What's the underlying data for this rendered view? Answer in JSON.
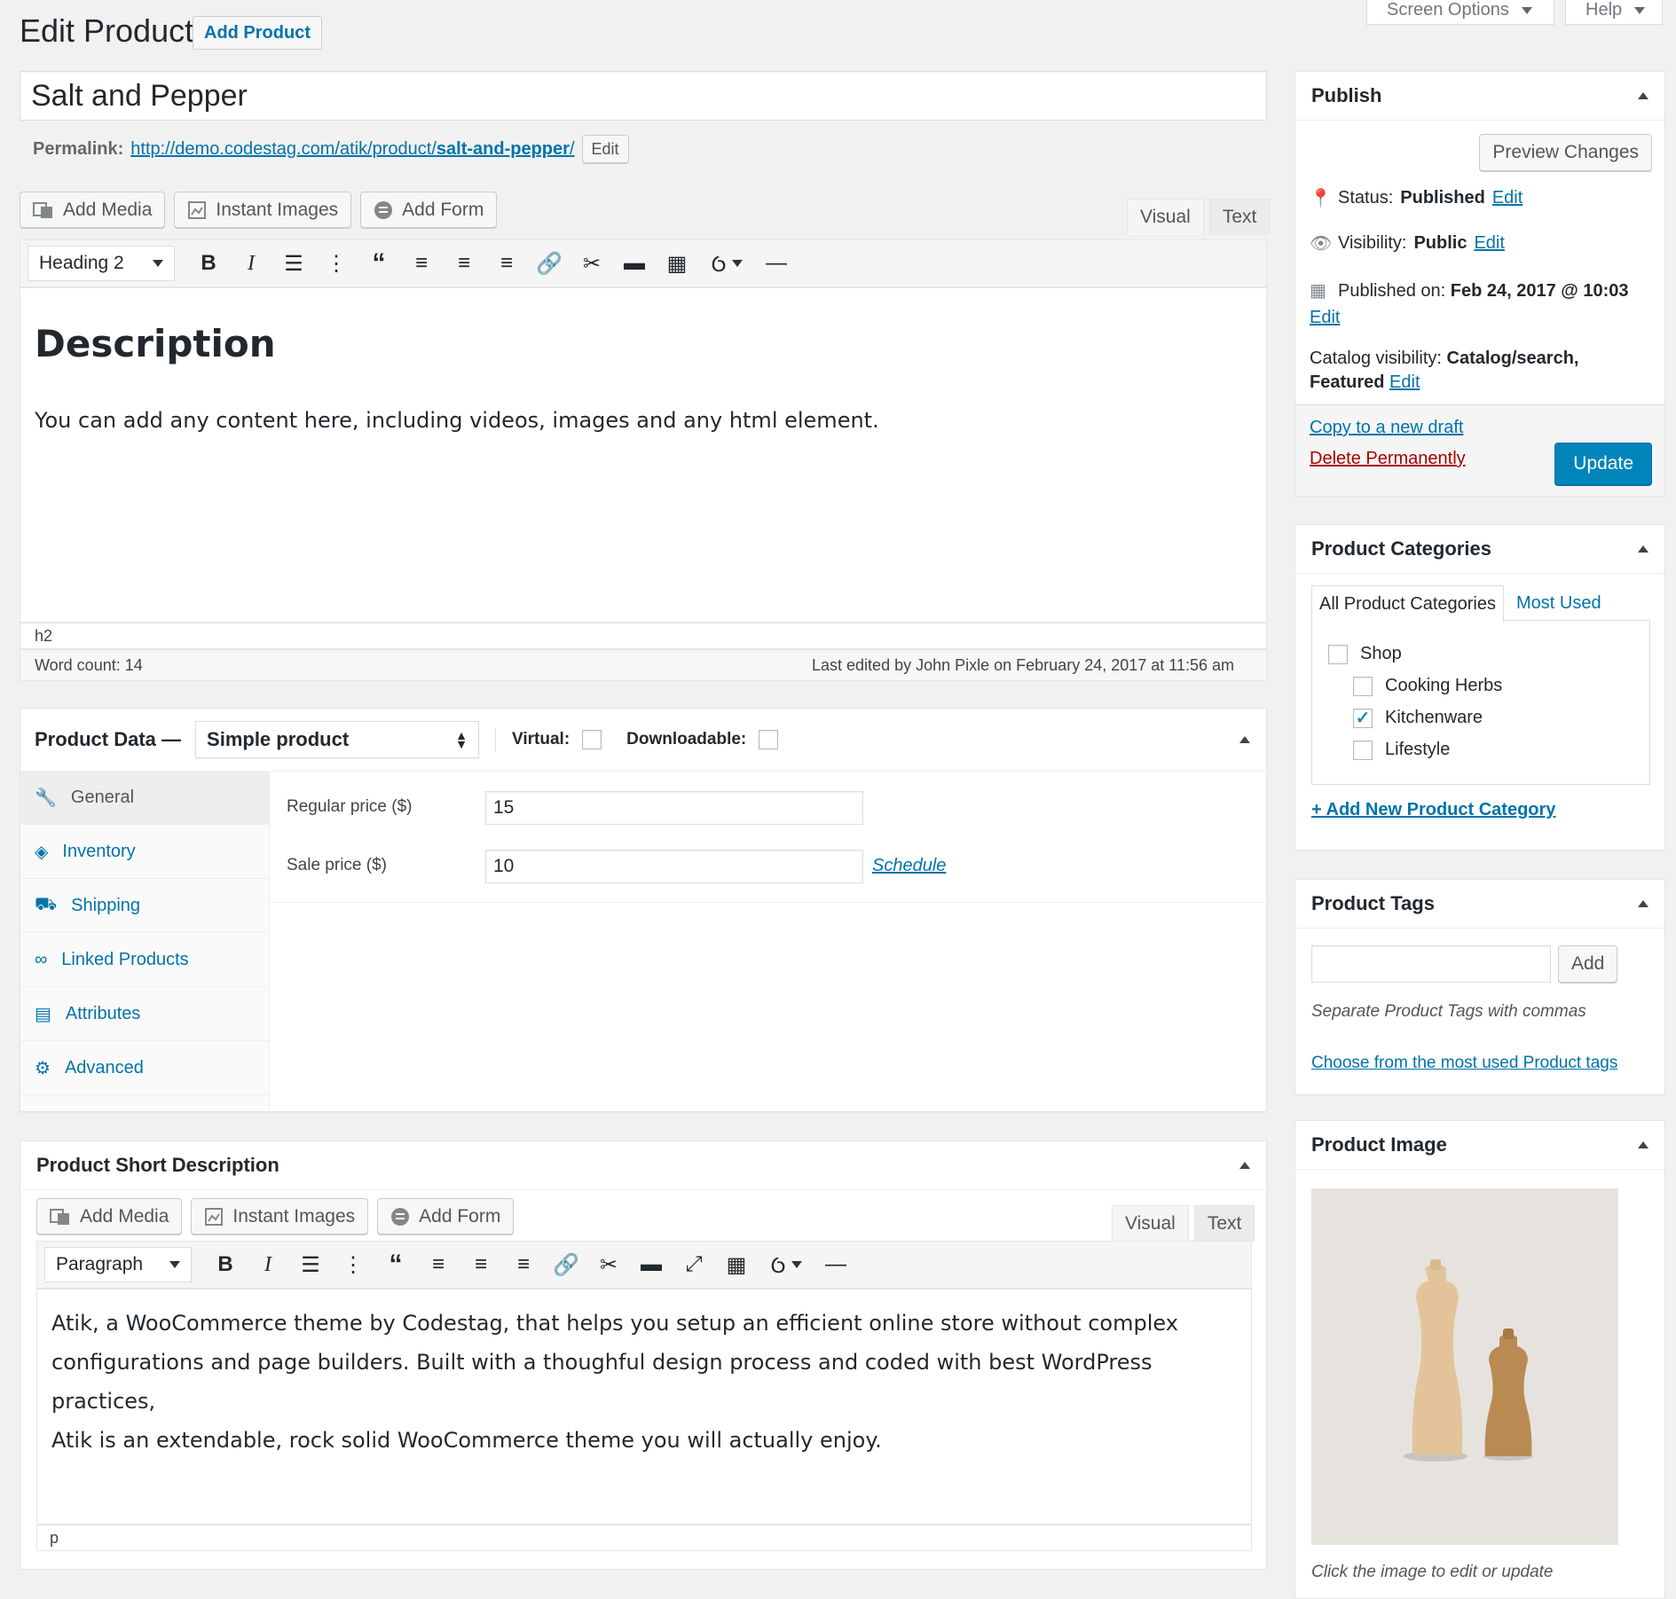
{
  "header": {
    "title": "Edit Product",
    "add_new": "Add Product",
    "screen_options": "Screen Options",
    "help": "Help"
  },
  "post": {
    "title": "Salt and Pepper",
    "permalink_label": "Permalink:",
    "permalink_base": "http://demo.codestag.com/atik/product/",
    "permalink_slug": "salt-and-pepper",
    "permalink_trail": "/",
    "permalink_edit": "Edit"
  },
  "media_buttons": {
    "add_media": "Add Media",
    "instant_images": "Instant Images",
    "add_form": "Add Form"
  },
  "editor": {
    "tab_visual": "Visual",
    "tab_text": "Text",
    "format": "Heading 2",
    "heading": "Description",
    "body": "You can add any content here, including videos, images and any html element.",
    "path": "h2",
    "word_count": "Word count: 14",
    "last_edited": "Last edited by John Pixle on February 24, 2017 at 11:56 am"
  },
  "product_data": {
    "label": "Product Data —",
    "type": "Simple product",
    "virtual_label": "Virtual:",
    "downloadable_label": "Downloadable:",
    "tabs": [
      {
        "label": "General",
        "icon": "wrench-icon"
      },
      {
        "label": "Inventory",
        "icon": "tag-icon"
      },
      {
        "label": "Shipping",
        "icon": "truck-icon"
      },
      {
        "label": "Linked Products",
        "icon": "link-icon"
      },
      {
        "label": "Attributes",
        "icon": "list-icon"
      },
      {
        "label": "Advanced",
        "icon": "gear-icon"
      }
    ],
    "regular_price_label": "Regular price ($)",
    "regular_price": "15",
    "sale_price_label": "Sale price ($)",
    "sale_price": "10",
    "schedule": "Schedule"
  },
  "short_description": {
    "title": "Product Short Description",
    "format": "Paragraph",
    "tab_visual": "Visual",
    "tab_text": "Text",
    "lines": [
      "Atik, a WooCommerce theme by Codestag, that helps you setup an efficient online store without complex",
      "configurations and page builders. Built with a thoughful design process and coded with best WordPress practices,",
      "Atik is an extendable, rock solid WooCommerce theme you will actually enjoy."
    ],
    "path": "p"
  },
  "publish": {
    "title": "Publish",
    "preview": "Preview Changes",
    "status_label": "Status:",
    "status_value": "Published",
    "visibility_label": "Visibility:",
    "visibility_value": "Public",
    "published_label": "Published on:",
    "published_value": "Feb 24, 2017 @ 10:03",
    "catalog_label": "Catalog visibility:",
    "catalog_value_1": "Catalog/search,",
    "catalog_value_2": "Featured",
    "edit": "Edit",
    "copy_draft": "Copy to a new draft",
    "delete": "Delete Permanently",
    "update": "Update"
  },
  "categories": {
    "title": "Product Categories",
    "tab_all": "All Product Categories",
    "tab_most_used": "Most Used",
    "items": [
      {
        "label": "Shop",
        "checked": false
      },
      {
        "label": "Cooking Herbs",
        "checked": false
      },
      {
        "label": "Kitchenware",
        "checked": true
      },
      {
        "label": "Lifestyle",
        "checked": false
      }
    ],
    "add_new": "+ Add New Product Category"
  },
  "tags": {
    "title": "Product Tags",
    "add": "Add",
    "hint": "Separate Product Tags with commas",
    "choose": "Choose from the most used Product tags"
  },
  "product_image": {
    "title": "Product Image",
    "hint": "Click the image to edit or update"
  },
  "colors": {
    "link": "#0073aa",
    "primary_button": "#0085ba",
    "delete": "#a00",
    "checkmark": "#1e8cbe"
  }
}
